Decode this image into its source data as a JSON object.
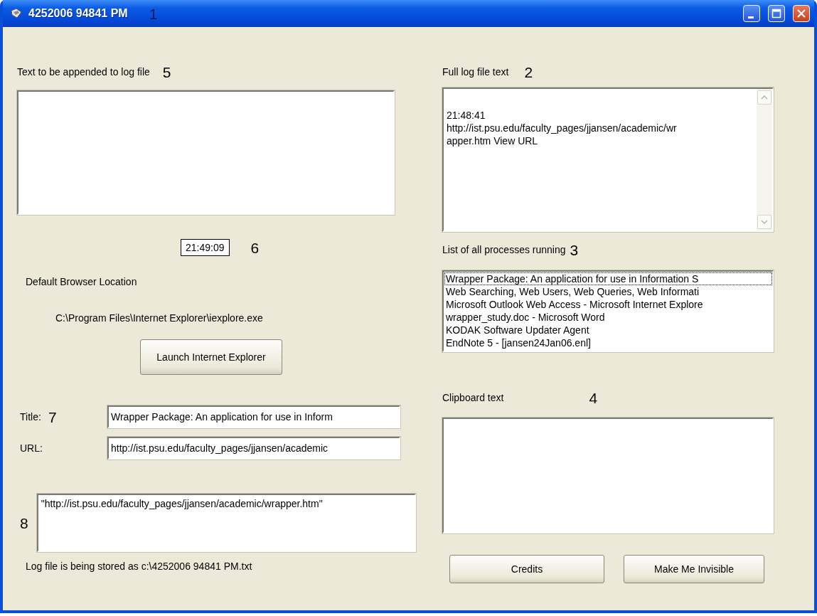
{
  "window": {
    "title": "4252006 94841 PM",
    "callout": "1"
  },
  "append_text": {
    "label": "Text to be appended to log file",
    "callout": "5"
  },
  "clock": {
    "value": "21:49:09",
    "callout": "6"
  },
  "browser": {
    "label": "Default Browser Location",
    "path": "C:\\Program Files\\Internet Explorer\\iexplore.exe",
    "button": "Launch Internet Explorer"
  },
  "page_info": {
    "callout": "7",
    "fields": [
      {
        "label": "Title:",
        "value": "Wrapper Package: An application for use in Inform"
      },
      {
        "label": "URL:",
        "value": "http://ist.psu.edu/faculty_pages/jjansen/academic"
      }
    ]
  },
  "link_box": {
    "callout": "8",
    "value": "\"http://ist.psu.edu/faculty_pages/jjansen/academic/wrapper.htm\""
  },
  "status": "Log file is being stored as c:\\4252006 94841 PM.txt",
  "log_file": {
    "label": "Full log file text",
    "callout": "2",
    "lines": [
      "21:48:41",
      "http://ist.psu.edu/faculty_pages/jjansen/academic/wr",
      "apper.htm View URL"
    ]
  },
  "processes": {
    "label": "List of all processes running",
    "callout": "3",
    "items": [
      {
        "text": "Wrapper Package: An application for use in Information S",
        "focused": true
      },
      {
        "text": "Web Searching, Web Users, Web Queries, Web Informati",
        "focused": false
      },
      {
        "text": "Microsoft Outlook Web Access - Microsoft Internet Explore",
        "focused": false
      },
      {
        "text": "wrapper_study.doc - Microsoft Word",
        "focused": false
      },
      {
        "text": "KODAK Software Updater Agent",
        "focused": false
      },
      {
        "text": "EndNote 5 - [jansen24Jan06.enl]",
        "focused": false
      }
    ]
  },
  "clipboard": {
    "label": "Clipboard text",
    "callout": "4"
  },
  "buttons": [
    "Credits",
    "Make Me Invisible"
  ]
}
